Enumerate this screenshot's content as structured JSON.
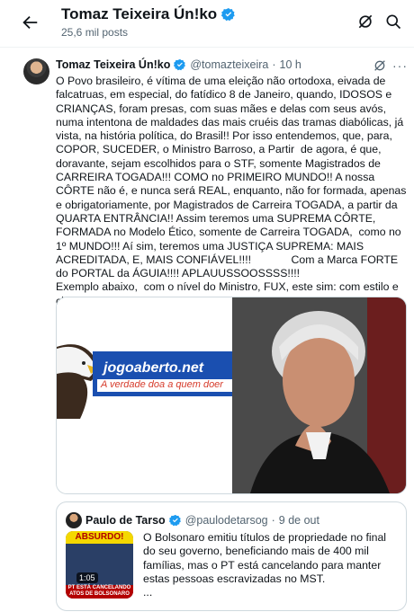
{
  "header": {
    "name": "Tomaz Teixeira Ún!ko",
    "posts": "25,6 mil posts"
  },
  "tweet": {
    "name": "Tomaz Teixeira Ún!ko",
    "handle": "@tomazteixeira",
    "sep": "·",
    "time": "10 h",
    "more": "···",
    "text": "O Povo brasileiro, é vítima de uma eleição não ortodoxa, eivada de falcatruas, em especial, do fatídico 8 de Janeiro, quando, IDOSOS e CRIANÇAS, foram presas, com suas mães e delas com seus avós, numa intentona de maldades das mais cruéis das tramas diabólicas, já vista, na história política, do Brasil!! Por isso entendemos, que, para, COPOR, SUCEDER, o Ministro Barroso, a Partir  de agora, é que, doravante, sejam escolhidos para o STF, somente Magistrados de CARREIRA TOGADA!!! COMO no PRIMEIRO MUNDO!! A nossa CÔRTE não é, e nunca será REAL, enquanto, não for formada, apenas e obrigatoriamente, por Magistrados de Carreira TOGADA, a partir da QUARTA ENTRÂNCIA!! Assim teremos uma SUPREMA CÔRTE, FORMADA no Modelo Ético, somente de Carreira TOGADA,  como no 1º MUNDO!!! Aí sim, teremos uma JUSTIÇA SUPREMA: MAIS ACREDITADA, E, MAIS CONFIÁVEL!!!!             Com a Marca FORTE do PORTAL da ÁGUIA!!!! APLAUUSSOOSSSS!!!!\nExemplo abaixo,  com o nível do Ministro, FUX, este sim: com estilo e classe, de quem advém de CARREIRA TOGADA!! Applaauussooss!!!",
    "media": {
      "left_brand": "jogoaberto.net",
      "left_slogan": "A verdade doa a quem doer"
    }
  },
  "quote": {
    "name": "Paulo de Tarso",
    "handle": "@paulodetarsog",
    "sep": "·",
    "time": "9 de out",
    "thumb_banner": "ABSURDO!",
    "thumb_duration": "1:05",
    "thumb_strip": "PT ESTÁ CANCELANDO ATOS DE BOLSONARO",
    "text": "O Bolsonaro emitiu títulos de propriedade no final do seu governo, beneficiando mais de 400 mil famílias, mas o PT está cancelando para manter estas pessoas escravizadas no MST.\n..."
  },
  "colors": {
    "verified": "#1d9bf0",
    "secondary_text": "#536471",
    "border": "#cfd9de"
  },
  "icons": [
    "back-arrow-icon",
    "verified-icon",
    "grok-icon",
    "search-icon",
    "more-icon"
  ]
}
